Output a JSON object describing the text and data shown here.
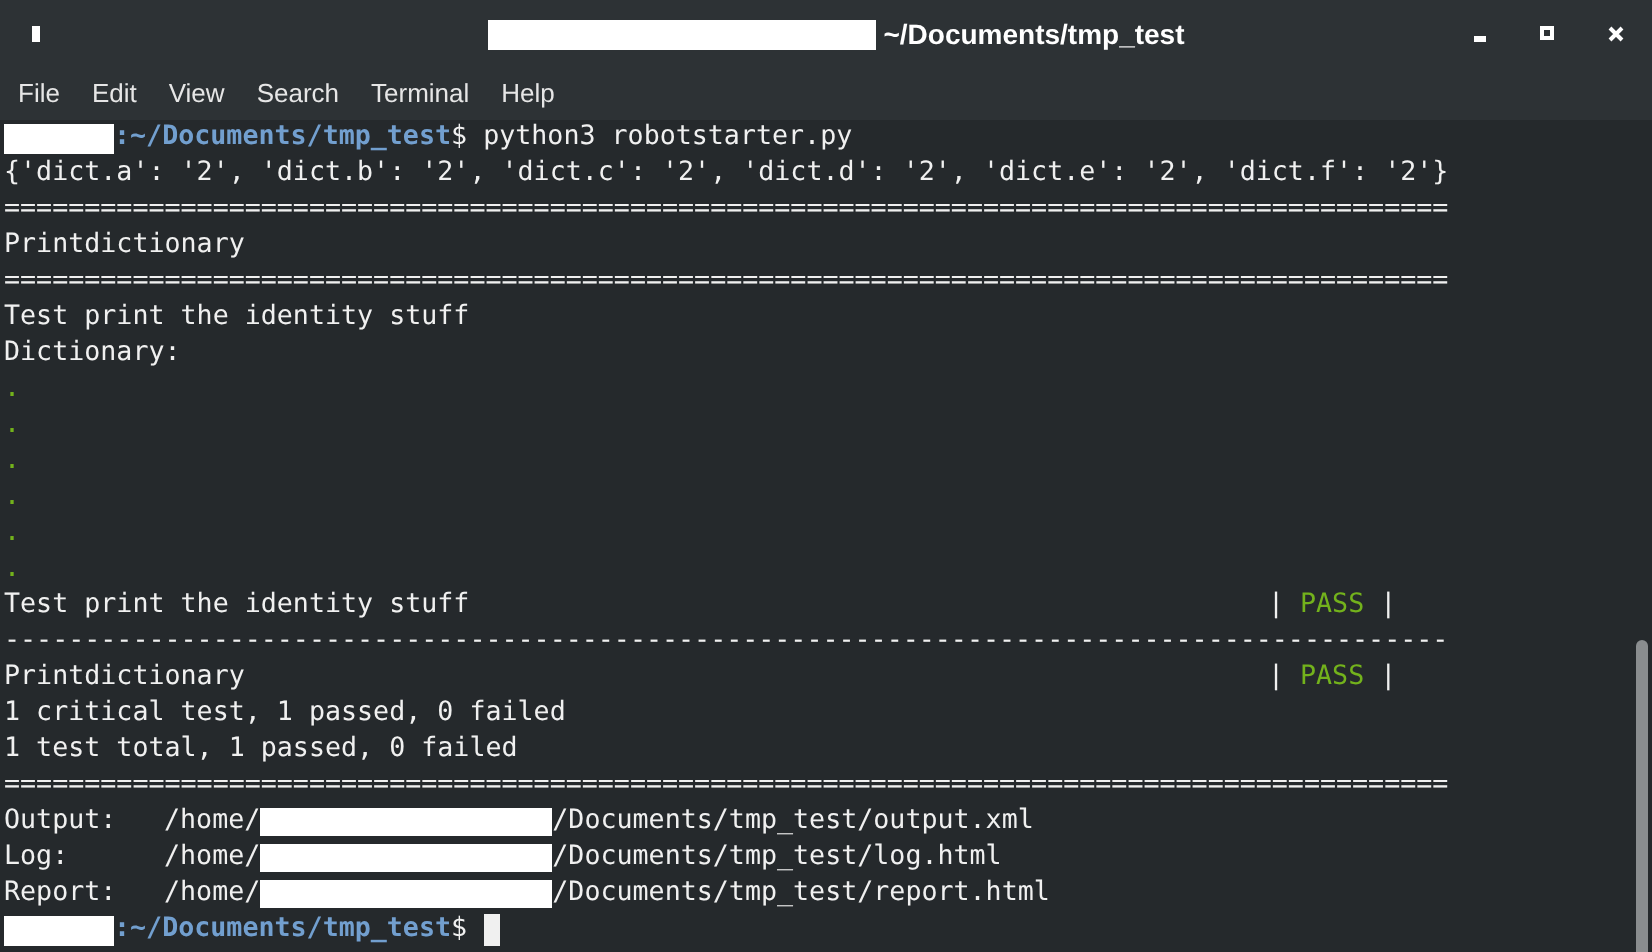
{
  "window": {
    "title": "~/Documents/tmp_test"
  },
  "menu": [
    {
      "label": "File"
    },
    {
      "label": "Edit"
    },
    {
      "label": "View"
    },
    {
      "label": "Search"
    },
    {
      "label": "Terminal"
    },
    {
      "label": "Help"
    }
  ],
  "terminal": {
    "lines": [
      {
        "kind": "prompt",
        "path": ":~/Documents/tmp_test",
        "symbol": "$",
        "command": " python3 robotstarter.py",
        "cursor": false
      },
      {
        "kind": "text",
        "text": "{'dict.a': '2', 'dict.b': '2', 'dict.c': '2', 'dict.d': '2', 'dict.e': '2', 'dict.f': '2'}"
      },
      {
        "kind": "rule",
        "text": "=========================================================================================="
      },
      {
        "kind": "text",
        "text": "Printdictionary"
      },
      {
        "kind": "rule",
        "text": "=========================================================================================="
      },
      {
        "kind": "text",
        "text": "Test print the identity stuff"
      },
      {
        "kind": "text",
        "text": "Dictionary:"
      },
      {
        "kind": "dot",
        "text": "."
      },
      {
        "kind": "dot",
        "text": "."
      },
      {
        "kind": "dot",
        "text": "."
      },
      {
        "kind": "dot",
        "text": "."
      },
      {
        "kind": "dot",
        "text": "."
      },
      {
        "kind": "dot",
        "text": "."
      },
      {
        "kind": "result",
        "name": "Test print the identity stuff",
        "bar_left": "|",
        "status": "PASS",
        "bar_right": "|"
      },
      {
        "kind": "rule",
        "text": "------------------------------------------------------------------------------------------"
      },
      {
        "kind": "result",
        "name": "Printdictionary",
        "bar_left": "|",
        "status": "PASS",
        "bar_right": "|"
      },
      {
        "kind": "text",
        "text": "1 critical test, 1 passed, 0 failed"
      },
      {
        "kind": "text",
        "text": "1 test total, 1 passed, 0 failed"
      },
      {
        "kind": "rule",
        "text": "=========================================================================================="
      },
      {
        "kind": "file",
        "label": "Output:",
        "prefix": "/home/",
        "suffix": "/Documents/tmp_test/output.xml"
      },
      {
        "kind": "file",
        "label": "Log:",
        "prefix": "/home/",
        "suffix": "/Documents/tmp_test/log.html"
      },
      {
        "kind": "file",
        "label": "Report:",
        "prefix": "/home/",
        "suffix": "/Documents/tmp_test/report.html"
      },
      {
        "kind": "prompt",
        "path": ":~/Documents/tmp_test",
        "symbol": "$",
        "cursor": true
      }
    ]
  }
}
